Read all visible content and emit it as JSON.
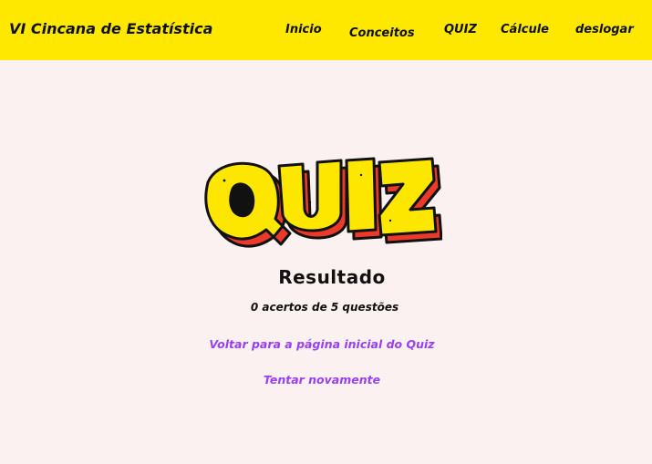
{
  "navbar": {
    "brand": "VI Cincana de Estatística",
    "links": [
      "Inicio",
      "Conceitos",
      "QUIZ",
      "Cálcule",
      "deslogar"
    ]
  },
  "logo": {
    "text": "QUIZ"
  },
  "result": {
    "title": "Resultado",
    "score_text": "0 acertos de 5 questões"
  },
  "links": {
    "back": "Voltar para a página inicial do Quiz",
    "retry": "Tentar novamente"
  },
  "colors": {
    "navbar_bg": "#fee800",
    "page_bg": "#fbf1f0",
    "link": "#9a3ff0",
    "logo_yellow": "#fde600",
    "logo_red": "#ea3a2a"
  }
}
